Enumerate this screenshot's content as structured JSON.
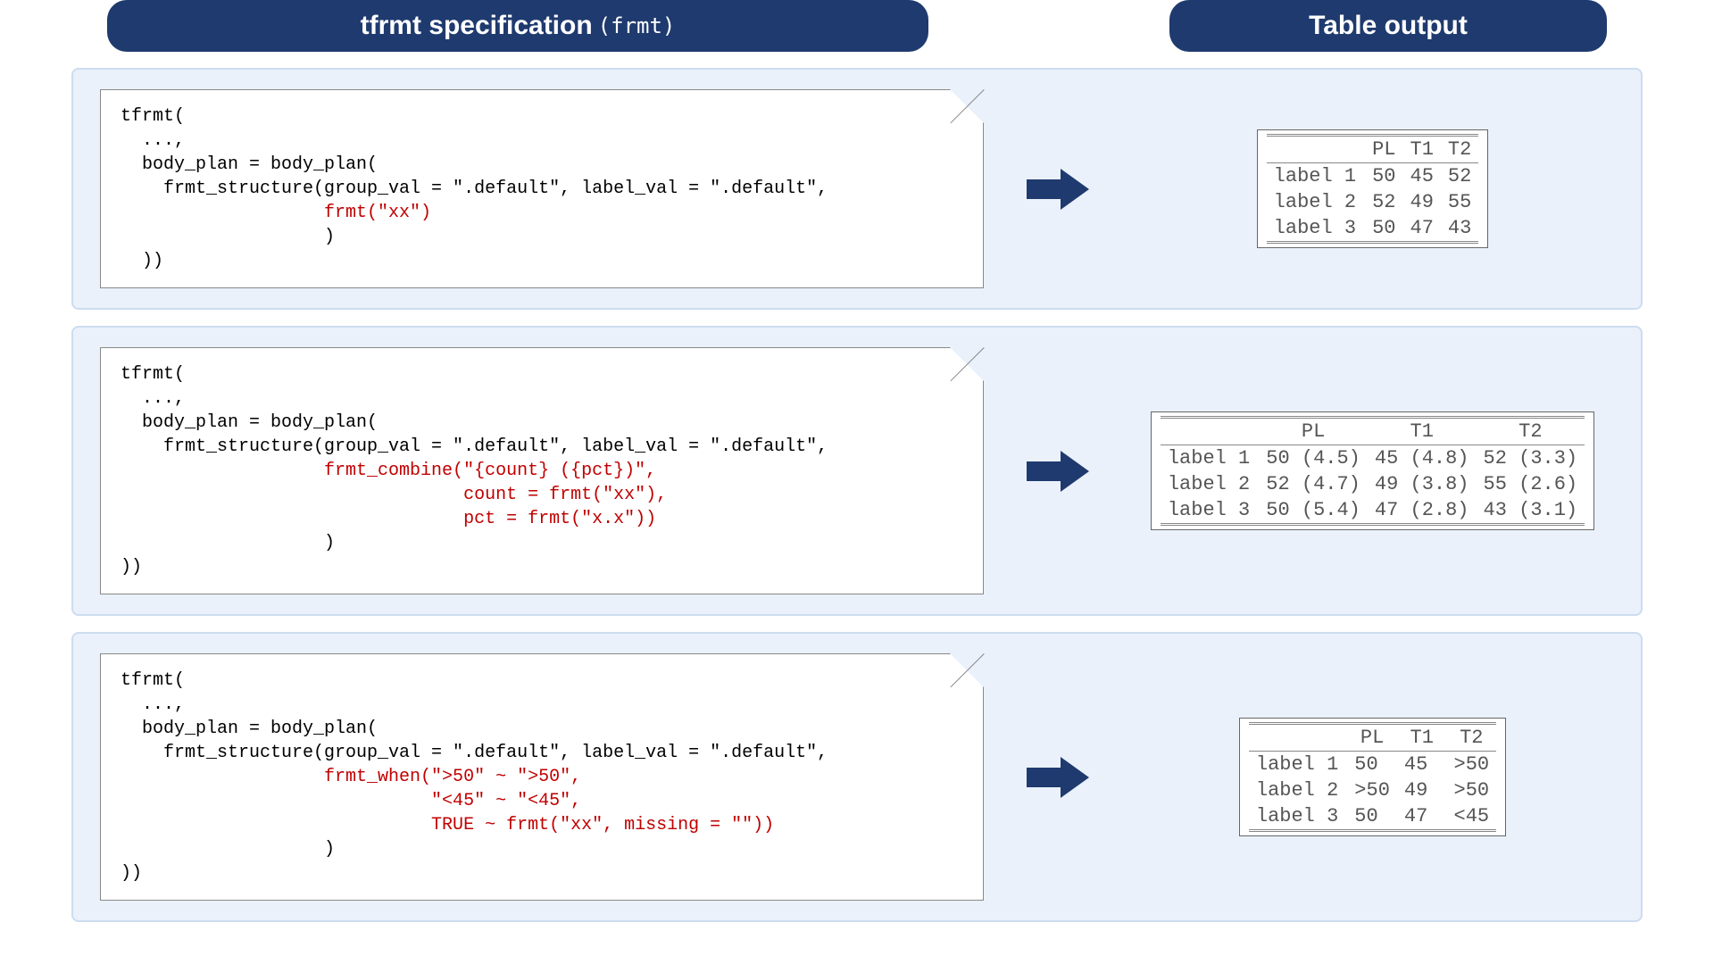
{
  "header": {
    "left_title": "tfrmt specification",
    "left_subtitle": "(frmt)",
    "right_title": "Table output"
  },
  "examples": [
    {
      "code": [
        {
          "t": "tfrmt(",
          "hl": false
        },
        {
          "t": "  ...,",
          "hl": false
        },
        {
          "t": "  body_plan = body_plan(",
          "hl": false
        },
        {
          "t": "    frmt_structure(group_val = \".default\", label_val = \".default\",",
          "hl": false
        },
        {
          "t": "                   frmt(\"xx\")",
          "hl": true
        },
        {
          "t": "                   )",
          "hl": false
        },
        {
          "t": "  ))",
          "hl": false
        }
      ],
      "table": {
        "columns": [
          "PL",
          "T1",
          "T2"
        ],
        "rows": [
          {
            "label": "label 1",
            "cells": [
              "50",
              "45",
              "52"
            ]
          },
          {
            "label": "label 2",
            "cells": [
              "52",
              "49",
              "55"
            ]
          },
          {
            "label": "label 3",
            "cells": [
              "50",
              "47",
              "43"
            ]
          }
        ]
      }
    },
    {
      "code": [
        {
          "t": "tfrmt(",
          "hl": false
        },
        {
          "t": "  ...,",
          "hl": false
        },
        {
          "t": "  body_plan = body_plan(",
          "hl": false
        },
        {
          "t": "    frmt_structure(group_val = \".default\", label_val = \".default\",",
          "hl": false
        },
        {
          "t": "                   frmt_combine(\"{count} ({pct})\",",
          "hl": true
        },
        {
          "t": "                                count = frmt(\"xx\"),",
          "hl": true
        },
        {
          "t": "                                pct = frmt(\"x.x\"))",
          "hl": true
        },
        {
          "t": "                   )",
          "hl": false
        },
        {
          "t": "))",
          "hl": false
        }
      ],
      "table": {
        "columns": [
          "PL",
          "T1",
          "T2"
        ],
        "rows": [
          {
            "label": "label 1",
            "cells": [
              "50 (4.5)",
              "45 (4.8)",
              "52 (3.3)"
            ]
          },
          {
            "label": "label 2",
            "cells": [
              "52 (4.7)",
              "49 (3.8)",
              "55 (2.6)"
            ]
          },
          {
            "label": "label 3",
            "cells": [
              "50 (5.4)",
              "47 (2.8)",
              "43 (3.1)"
            ]
          }
        ]
      }
    },
    {
      "code": [
        {
          "t": "tfrmt(",
          "hl": false
        },
        {
          "t": "  ...,",
          "hl": false
        },
        {
          "t": "  body_plan = body_plan(",
          "hl": false
        },
        {
          "t": "    frmt_structure(group_val = \".default\", label_val = \".default\",",
          "hl": false
        },
        {
          "t": "                   frmt_when(\">50\" ~ \">50\",",
          "hl": true
        },
        {
          "t": "                             \"<45\" ~ \"<45\",",
          "hl": true
        },
        {
          "t": "                             TRUE ~ frmt(\"xx\", missing = \"\"))",
          "hl": true
        },
        {
          "t": "                   )",
          "hl": false
        },
        {
          "t": "))",
          "hl": false
        }
      ],
      "table": {
        "columns": [
          "PL",
          "T1",
          "T2"
        ],
        "rows": [
          {
            "label": "label 1",
            "cells": [
              "50 ",
              "45 ",
              ">50"
            ]
          },
          {
            "label": "label 2",
            "cells": [
              ">50",
              "49 ",
              ">50"
            ]
          },
          {
            "label": "label 3",
            "cells": [
              "50 ",
              "47 ",
              "<45"
            ]
          }
        ]
      }
    }
  ]
}
